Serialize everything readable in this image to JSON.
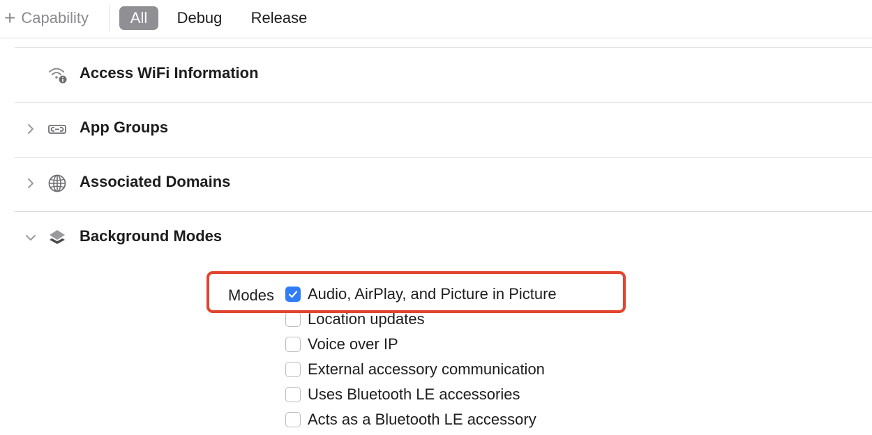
{
  "toolbar": {
    "add_capability": "Capability",
    "filters": [
      "All",
      "Debug",
      "Release"
    ],
    "active_filter": "All"
  },
  "capabilities": [
    {
      "title": "Access WiFi Information",
      "icon": "wifi-info-icon",
      "expandable": false
    },
    {
      "title": "App Groups",
      "icon": "app-groups-icon",
      "expandable": true,
      "expanded": false
    },
    {
      "title": "Associated Domains",
      "icon": "globe-icon",
      "expandable": true,
      "expanded": false
    },
    {
      "title": "Background Modes",
      "icon": "layers-icon",
      "expandable": true,
      "expanded": true
    }
  ],
  "background_modes": {
    "label": "Modes",
    "items": [
      {
        "label": "Audio, AirPlay, and Picture in Picture",
        "checked": true
      },
      {
        "label": "Location updates",
        "checked": false
      },
      {
        "label": "Voice over IP",
        "checked": false
      },
      {
        "label": "External accessory communication",
        "checked": false
      },
      {
        "label": "Uses Bluetooth LE accessories",
        "checked": false
      },
      {
        "label": "Acts as a Bluetooth LE accessory",
        "checked": false
      }
    ]
  },
  "colors": {
    "accent_blue": "#2f7cf6",
    "highlight_red": "#e2452f",
    "active_segment": "#8f8f94"
  }
}
